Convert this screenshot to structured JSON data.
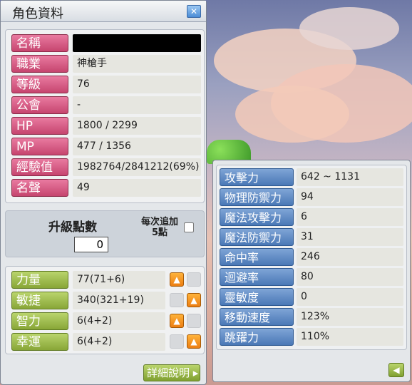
{
  "window": {
    "title": "角色資料",
    "close_icon": "close-icon"
  },
  "profile": [
    {
      "label": "名稱",
      "value": "",
      "redacted": true
    },
    {
      "label": "職業",
      "value": "神槍手"
    },
    {
      "label": "等級",
      "value": "76"
    },
    {
      "label": "公會",
      "value": "-"
    },
    {
      "label": "HP",
      "value": "1800 / 2299"
    },
    {
      "label": "MP",
      "value": "477 / 1356"
    },
    {
      "label": "經驗值",
      "value": "1982764/2841212(69%)"
    },
    {
      "label": "名聲",
      "value": "49"
    }
  ],
  "level_up": {
    "label": "升級點數",
    "points": "0",
    "auto_label": "每次追加5點",
    "auto_checked": false
  },
  "stats": [
    {
      "label": "力量",
      "value": "77(71+6)",
      "up_enabled": true
    },
    {
      "label": "敏捷",
      "value": "340(321+19)",
      "up_enabled": true
    },
    {
      "label": "智力",
      "value": "6(4+2)",
      "up_enabled": true
    },
    {
      "label": "幸運",
      "value": "6(4+2)",
      "up_enabled": true
    }
  ],
  "detail_button": "詳細說明",
  "details": [
    {
      "label": "攻擊力",
      "value": "642 ~ 1131"
    },
    {
      "label": "物理防禦力",
      "value": "94"
    },
    {
      "label": "魔法攻擊力",
      "value": "6"
    },
    {
      "label": "魔法防禦力",
      "value": "31"
    },
    {
      "label": "命中率",
      "value": "246"
    },
    {
      "label": "迴避率",
      "value": "80"
    },
    {
      "label": "靈敏度",
      "value": "0"
    },
    {
      "label": "移動速度",
      "value": "123%"
    },
    {
      "label": "跳躍力",
      "value": "110%"
    }
  ],
  "colors": {
    "label_pink": "#d65a84",
    "label_green": "#9bbd4c",
    "label_blue": "#5a86c2",
    "up_arrow": "#f08a1a"
  }
}
